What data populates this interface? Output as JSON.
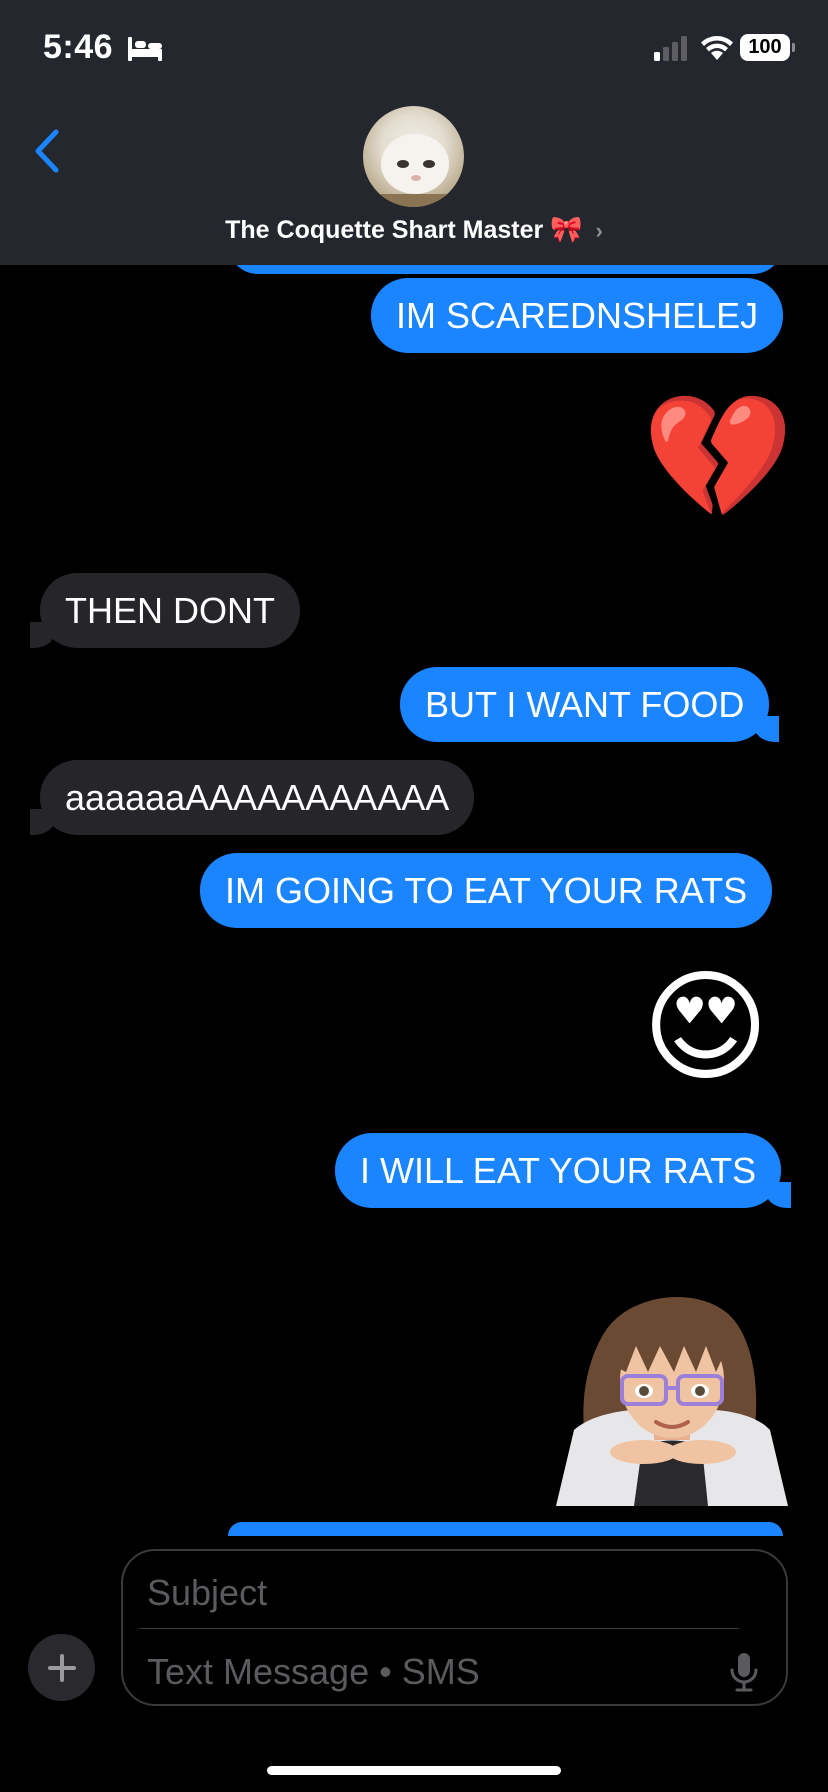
{
  "status_bar": {
    "time": "5:46",
    "battery": "100",
    "icons": [
      "bed-icon",
      "cellular-signal-icon",
      "wifi-icon",
      "battery-icon"
    ]
  },
  "header": {
    "contact_name": "The Coquette Shart Master",
    "name_emoji": "🎀",
    "chevron": "›",
    "back_icon": "chevron-left-icon",
    "accent": "#1b84ff"
  },
  "messages": [
    {
      "side": "sent",
      "text": "IM SCAREDNSHELEJ"
    },
    {
      "side": "sent",
      "emoji": "💔"
    },
    {
      "side": "received",
      "text": "THEN DONT"
    },
    {
      "side": "sent",
      "text": "BUT I WANT FOOD"
    },
    {
      "side": "received",
      "text": "aaaaaaAAAAAAAAAAA"
    },
    {
      "side": "sent",
      "text": "IM GOING TO EAT YOUR RATS"
    },
    {
      "side": "sent",
      "emoji": "😍"
    },
    {
      "side": "sent",
      "text": "I WILL EAT YOUR RATS"
    },
    {
      "side": "sent",
      "sticker": "memoji-sticker"
    }
  ],
  "composer": {
    "subject_placeholder": "Subject",
    "message_placeholder": "Text Message • SMS",
    "plus_icon": "plus-icon",
    "mic_icon": "microphone-icon"
  },
  "colors": {
    "sent_bubble": "#1b84ff",
    "received_bubble": "#26262a",
    "header_bg": "#25272e",
    "background": "#000000"
  }
}
